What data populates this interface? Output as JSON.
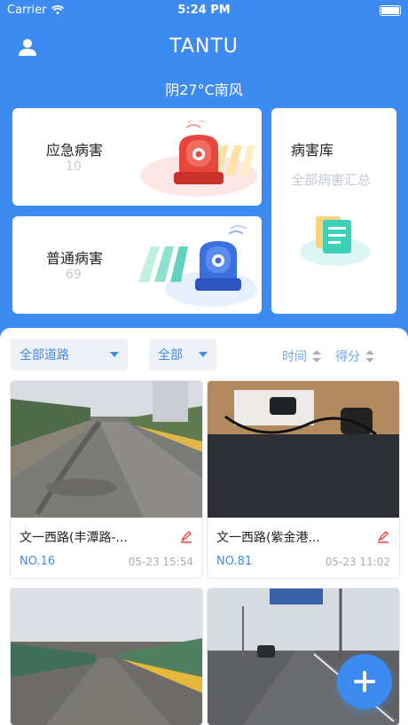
{
  "status_bar": {
    "carrier": "Carrier",
    "time": "5:24 PM"
  },
  "header": {
    "title": "TANTU",
    "weather": "阴27°C南风",
    "user_icon": "user-icon"
  },
  "cards": {
    "emergency": {
      "label": "应急病害",
      "count": "10"
    },
    "normal": {
      "label": "普通病害",
      "count": "69"
    },
    "library": {
      "label": "病害库",
      "sub": "全部病害汇总"
    }
  },
  "filters": {
    "road": "全部道路",
    "type": "全部",
    "sort_time": "时间",
    "sort_score": "得分"
  },
  "tiles": [
    {
      "title": "文一西路(丰潭路-...",
      "no": "NO.16",
      "date": "05-23 15:54"
    },
    {
      "title": "文一西路(紫金港...",
      "no": "NO.81",
      "date": "05-23 11:02"
    },
    {
      "title": "",
      "no": "",
      "date": ""
    },
    {
      "title": "",
      "no": "",
      "date": ""
    }
  ],
  "fab": {
    "icon": "plus-icon"
  },
  "colors": {
    "primary": "#3d8bf0",
    "emergency": "#e8453c",
    "normal": "#3b6fe0"
  }
}
